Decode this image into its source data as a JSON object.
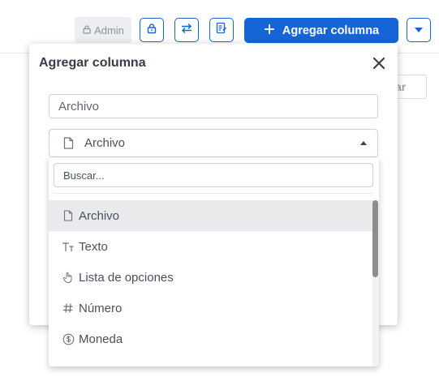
{
  "toolbar": {
    "admin_label": "Admin",
    "add_column_label": "Agregar columna",
    "accent": "#1565d8"
  },
  "background": {
    "partial_button_text": "ar"
  },
  "modal": {
    "title": "Agregar columna",
    "name_value": "Archivo",
    "type_selected": "Archivo"
  },
  "dropdown": {
    "search_placeholder": "Buscar...",
    "options": [
      {
        "label": "Archivo",
        "icon": "file-icon",
        "selected": true
      },
      {
        "label": "Texto",
        "icon": "text-type-icon",
        "selected": false
      },
      {
        "label": "Lista de opciones",
        "icon": "hand-pointer-icon",
        "selected": false
      },
      {
        "label": "Número",
        "icon": "hash-icon",
        "selected": false
      },
      {
        "label": "Moneda",
        "icon": "dollar-circle-icon",
        "selected": false
      }
    ]
  }
}
